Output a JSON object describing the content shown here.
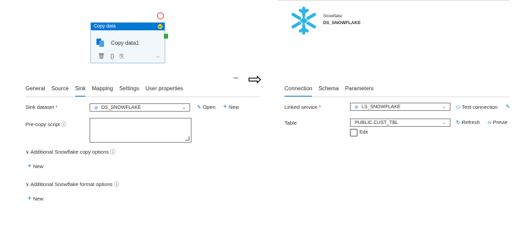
{
  "activity": {
    "header": "Copy data",
    "name": "Copy data1",
    "tool_icons": [
      "delete-icon",
      "code-icon",
      "copy-icon",
      "arrow-right-circle-icon"
    ]
  },
  "brand": {
    "line1": "Snowflake",
    "line2": "DS_SNOWFLAKE",
    "logo_color": "#29b5e8"
  },
  "separator": {
    "dash": "–",
    "arrow": "⇨"
  },
  "left_panel": {
    "tabs": [
      "General",
      "Source",
      "Sink",
      "Mapping",
      "Settings",
      "User properties"
    ],
    "active_tab": "Sink",
    "sink_dataset_label": "Sink dataset",
    "required_mark": "*",
    "sink_dataset_value": "DS_SNOWFLAKE",
    "open_label": "Open",
    "new_label": "New",
    "precopy_label": "Pre-copy script",
    "info_glyph": "ⓘ",
    "section1": "Additional Snowflake copy options",
    "section1_new": "New",
    "section2": "Additional Snowflake format options",
    "section2_new": "New"
  },
  "right_panel": {
    "tabs": [
      "Connection",
      "Schema",
      "Parameters"
    ],
    "active_tab": "Connection",
    "linked_service_label": "Linked service",
    "required_mark": "*",
    "linked_service_value": "LS_SNOWFLAKE",
    "test_connection_label": "Test connection",
    "table_label": "Table",
    "table_value": "PUBLIC.CUST_TBL",
    "refresh_label": "Refresh",
    "preview_label": "Previe",
    "edit_label": "Edit"
  },
  "colors": {
    "accent": "#0078d4",
    "card_header": "#0078d4",
    "success": "#38a640",
    "error": "#d13438"
  }
}
